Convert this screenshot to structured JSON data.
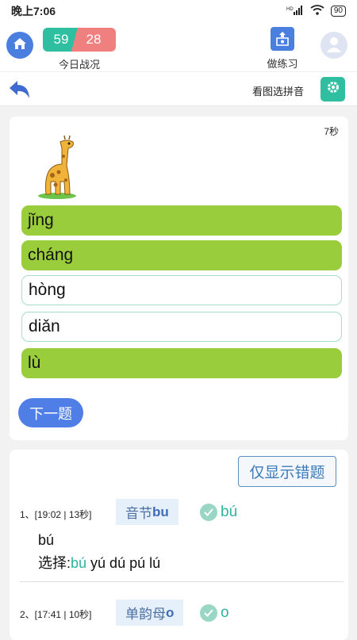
{
  "status": {
    "time": "晚上7:06",
    "signal": "HD",
    "battery": "90"
  },
  "top": {
    "score_correct": "59",
    "score_wrong": "28",
    "today_label": "今日战况",
    "practice_label": "做练习"
  },
  "sub": {
    "mode_label": "看图选拼音"
  },
  "quiz": {
    "timer": "7秒",
    "options": [
      {
        "label": "jǐng",
        "state": "selected"
      },
      {
        "label": "cháng",
        "state": "selected"
      },
      {
        "label": "hòng",
        "state": "unselected"
      },
      {
        "label": "diǎn",
        "state": "unselected"
      },
      {
        "label": "lù",
        "state": "selected"
      }
    ],
    "next_label": "下一题"
  },
  "history": {
    "filter_label": "仅显示错题",
    "records": [
      {
        "meta": "1、[19:02 | 13秒]",
        "tag_prefix": "音节",
        "tag_value": "bu",
        "answer": "bú",
        "line1": "bú",
        "choice_label": "选择:",
        "choice_highlight": "bú",
        "choice_rest": " yú dú pú lú"
      },
      {
        "meta": "2、[17:41 | 10秒]",
        "tag_prefix": "单韵母",
        "tag_value": "o",
        "answer": "o"
      }
    ]
  },
  "colors": {
    "accent_blue": "#4a7fe0",
    "teal": "#2fbfa0",
    "red": "#f08080",
    "green_sel": "#9acd3c"
  },
  "icons": [
    "home-icon",
    "practice-icon",
    "avatar-icon",
    "back-arrow-icon",
    "gear-icon",
    "giraffe-image",
    "check-icon"
  ]
}
